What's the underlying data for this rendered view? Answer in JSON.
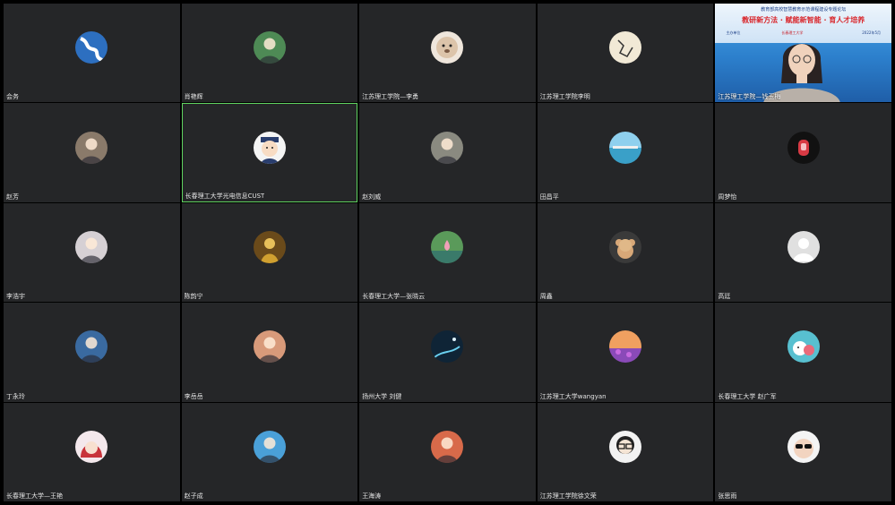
{
  "meeting": {
    "video_banner": {
      "line1": "教育部高校智慧教育示范课程建设专题论坛",
      "line2": "教研新方法 · 赋能新智能 · 育人才培养",
      "line3": "主办单位",
      "line4": "长春理工大学",
      "line5": "2022年5月"
    },
    "participants": [
      {
        "name": "会务",
        "avatar": "blue-wave-avatar",
        "color": "#2b68b5"
      },
      {
        "name": "肖艳辉",
        "avatar": "man-portrait-avatar",
        "color": "#4e8a55"
      },
      {
        "name": "江苏理工学院—李勇",
        "avatar": "plush-toy-avatar",
        "color": "#d8c3ad"
      },
      {
        "name": "江苏理工学院李明",
        "avatar": "ink-sketch-avatar",
        "color": "#efe7d4"
      },
      {
        "name": "江苏理工学院—钱玉梅",
        "avatar": "camera-video-feed",
        "color": "#3a8ee0"
      },
      {
        "name": "赵芳",
        "avatar": "rock-climbing-avatar",
        "color": "#8a7a6a"
      },
      {
        "name": "长春理工大学光电信息CUST",
        "avatar": "cartoon-graduate-avatar",
        "color": "#3c5a8c"
      },
      {
        "name": "赵刘威",
        "avatar": "animal-photo-avatar",
        "color": "#8a8a80"
      },
      {
        "name": "田昌平",
        "avatar": "seaside-avatar",
        "color": "#4fb4d8"
      },
      {
        "name": "周梦怡",
        "avatar": "red-sticker-avatar",
        "color": "#c8333a"
      },
      {
        "name": "李浩宇",
        "avatar": "anime-white-hair-avatar",
        "color": "#d6d0d4"
      },
      {
        "name": "陈韵宁",
        "avatar": "golden-figure-avatar",
        "color": "#b08a2a"
      },
      {
        "name": "长春理工大学—张晓云",
        "avatar": "lotus-avatar",
        "color": "#4a8a4a"
      },
      {
        "name": "周鑫",
        "avatar": "teddy-bear-avatar",
        "color": "#c89a6a"
      },
      {
        "name": "高廷",
        "avatar": "default-person-avatar",
        "color": "#d8d8d8"
      },
      {
        "name": "丁永玲",
        "avatar": "sunset-figure-avatar",
        "color": "#3a6aa0"
      },
      {
        "name": "李岳岳",
        "avatar": "woman-photo-avatar",
        "color": "#d89a7a"
      },
      {
        "name": "扬州大学 刘健",
        "avatar": "night-sky-avatar",
        "color": "#18384e"
      },
      {
        "name": "江苏理工大学wangyan",
        "avatar": "flower-field-avatar",
        "color": "#8a5ac8"
      },
      {
        "name": "长春理工大学 赵广军",
        "avatar": "cartoon-animals-avatar",
        "color": "#4fb8c8"
      },
      {
        "name": "长春理工大学—王艳",
        "avatar": "cartoon-girl-avatar",
        "color": "#c83a4a"
      },
      {
        "name": "赵子成",
        "avatar": "man-suit-avatar",
        "color": "#4aa0d8"
      },
      {
        "name": "王海涛",
        "avatar": "man-green-shirt-avatar",
        "color": "#d86a4a"
      },
      {
        "name": "江苏理工学院徐文荣",
        "avatar": "cartoon-glasses-avatar",
        "color": "#e8e8e8"
      },
      {
        "name": "张思雨",
        "avatar": "baby-sunglasses-avatar",
        "color": "#f0d8c8"
      }
    ],
    "active_speaker_index": 6,
    "video_index": 4,
    "speaking_border_color": "#5fd25f",
    "tile_background": "#252628"
  }
}
